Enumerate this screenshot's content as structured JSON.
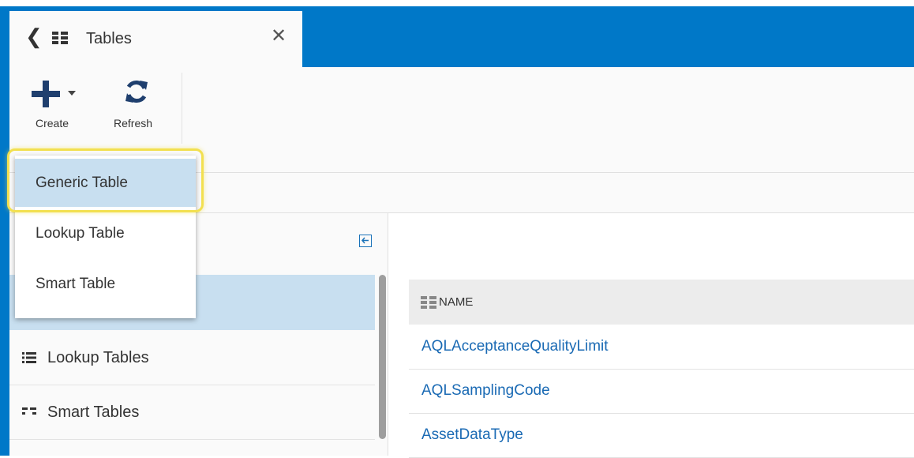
{
  "tab": {
    "title": "Tables",
    "back_icon": "chevron-left-icon",
    "close_icon": "close-icon"
  },
  "toolbar": {
    "create_label": "Create",
    "refresh_label": "Refresh"
  },
  "dropdown": {
    "items": [
      "Generic Table",
      "Lookup Table",
      "Smart Table"
    ],
    "selected_index": 0
  },
  "nav": {
    "items": [
      {
        "label": "Lookup Tables",
        "icon": "list-icon"
      },
      {
        "label": "Smart Tables",
        "icon": "smart-table-icon"
      }
    ]
  },
  "grid": {
    "column_header": "NAME",
    "rows": [
      "AQLAcceptanceQualityLimit",
      "AQLSamplingCode",
      "AssetDataType"
    ]
  },
  "colors": {
    "brand_blue": "#0078c8",
    "selection": "#c8dff0",
    "link": "#1a6ab4",
    "highlight": "#f2e050"
  }
}
